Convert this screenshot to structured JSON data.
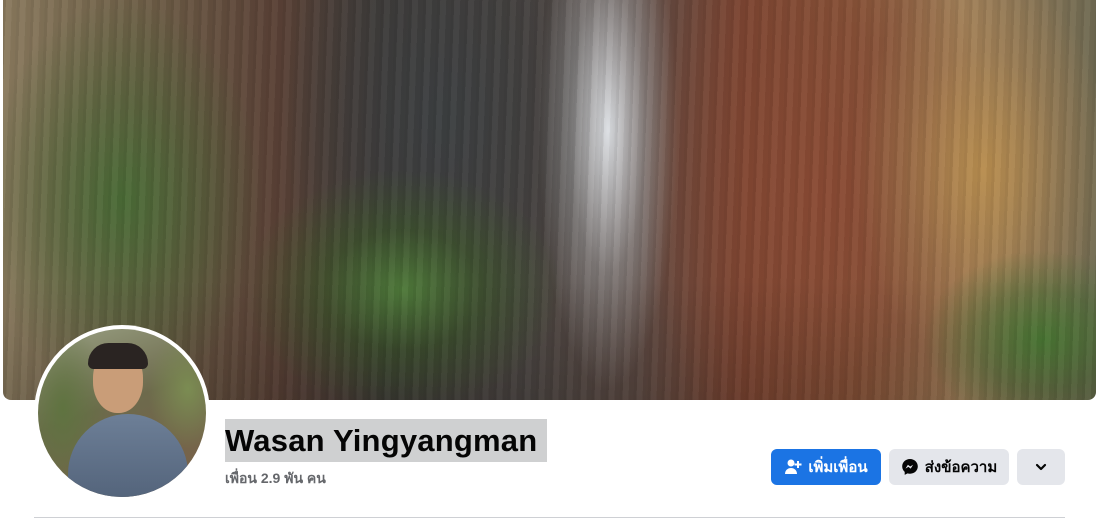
{
  "profile": {
    "name": "Wasan Yingyangman",
    "friends_count": "เพื่อน 2.9 พัน คน"
  },
  "actions": {
    "add_friend_label": "เพิ่มเพื่อน",
    "message_label": "ส่งข้อความ",
    "more_icon": "chevron-down-icon"
  },
  "colors": {
    "primary": "#1b74e4",
    "secondary": "#e4e6eb",
    "name_highlight": "#cfd0d1"
  }
}
